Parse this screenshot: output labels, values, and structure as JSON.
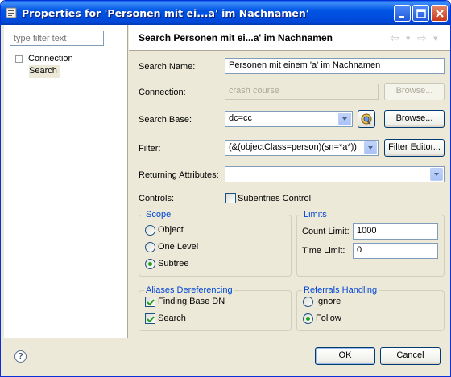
{
  "window": {
    "title": "Properties for 'Personen mit ei...a' im Nachnamen'"
  },
  "sidebar": {
    "filter_placeholder": "type filter text",
    "items": [
      {
        "label": "Connection"
      },
      {
        "label": "Search"
      }
    ]
  },
  "page": {
    "title": "Search Personen mit ei...a' im Nachnamen"
  },
  "form": {
    "search_name_label": "Search Name:",
    "search_name_value": "Personen mit einem 'a' im Nachnamen",
    "connection_label": "Connection:",
    "connection_value": "crash course",
    "connection_browse_label": "Browse...",
    "search_base_label": "Search Base:",
    "search_base_value": "dc=cc",
    "search_base_browse_label": "Browse...",
    "filter_label": "Filter:",
    "filter_value": "(&(objectClass=person)(sn=*a*))",
    "filter_editor_label": "Filter Editor...",
    "returning_attributes_label": "Returning Attributes:",
    "returning_attributes_value": "",
    "controls_label": "Controls:",
    "subentries_control_label": "Subentries Control",
    "subentries_control_checked": false
  },
  "scope": {
    "title": "Scope",
    "options": [
      {
        "label": "Object",
        "checked": false
      },
      {
        "label": "One Level",
        "checked": false
      },
      {
        "label": "Subtree",
        "checked": true
      }
    ]
  },
  "limits": {
    "title": "Limits",
    "count_limit_label": "Count Limit:",
    "count_limit_value": "1000",
    "time_limit_label": "Time Limit:",
    "time_limit_value": "0"
  },
  "aliases": {
    "title": "Aliases Dereferencing",
    "finding_base_dn_label": "Finding Base DN",
    "finding_base_dn_checked": true,
    "search_label": "Search",
    "search_checked": true
  },
  "referrals": {
    "title": "Referrals Handling",
    "options": [
      {
        "label": "Ignore",
        "checked": false
      },
      {
        "label": "Follow",
        "checked": true
      }
    ]
  },
  "footer": {
    "ok_label": "OK",
    "cancel_label": "Cancel",
    "help_glyph": "?"
  },
  "colors": {
    "title_bar": "#0055E5",
    "group_title": "#0046D5",
    "dialog_background": "#ECE9D8"
  }
}
